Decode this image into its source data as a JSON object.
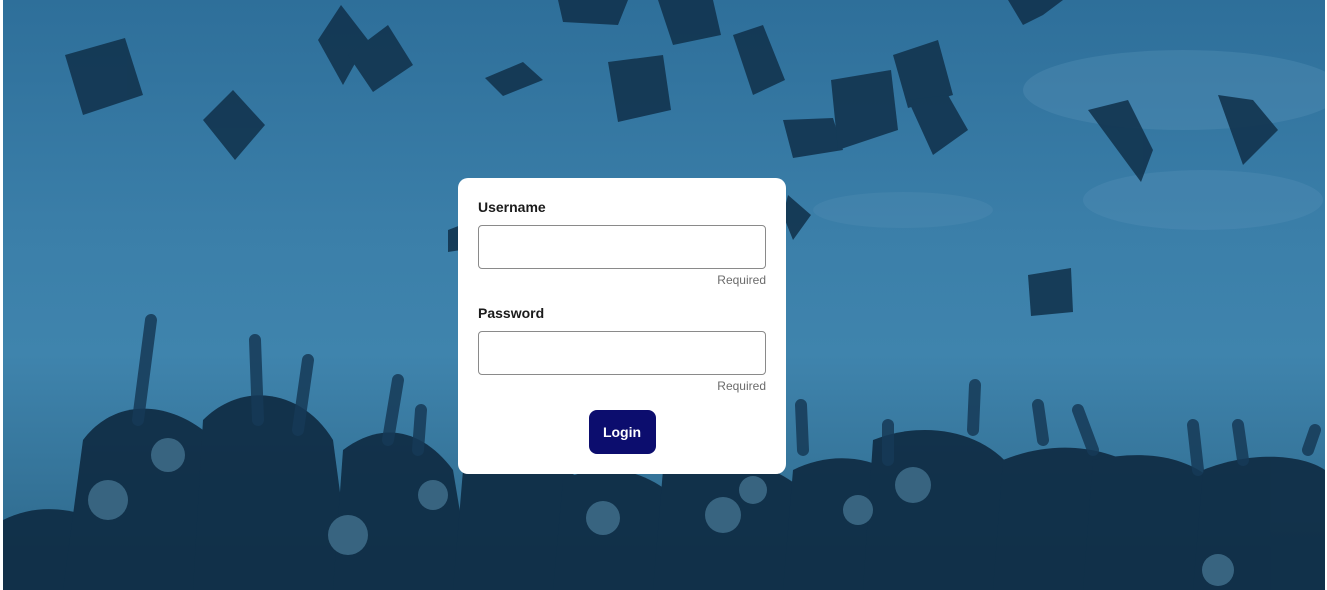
{
  "form": {
    "username": {
      "label": "Username",
      "value": "",
      "placeholder": "",
      "hint": "Required"
    },
    "password": {
      "label": "Password",
      "value": "",
      "placeholder": "",
      "hint": "Required"
    },
    "login_label": "Login"
  },
  "colors": {
    "background_overlay": "#2e6f9a",
    "login_button": "#0c0d6e",
    "card": "#ffffff"
  },
  "background": {
    "image": "graduation-caps-toss-photo"
  }
}
